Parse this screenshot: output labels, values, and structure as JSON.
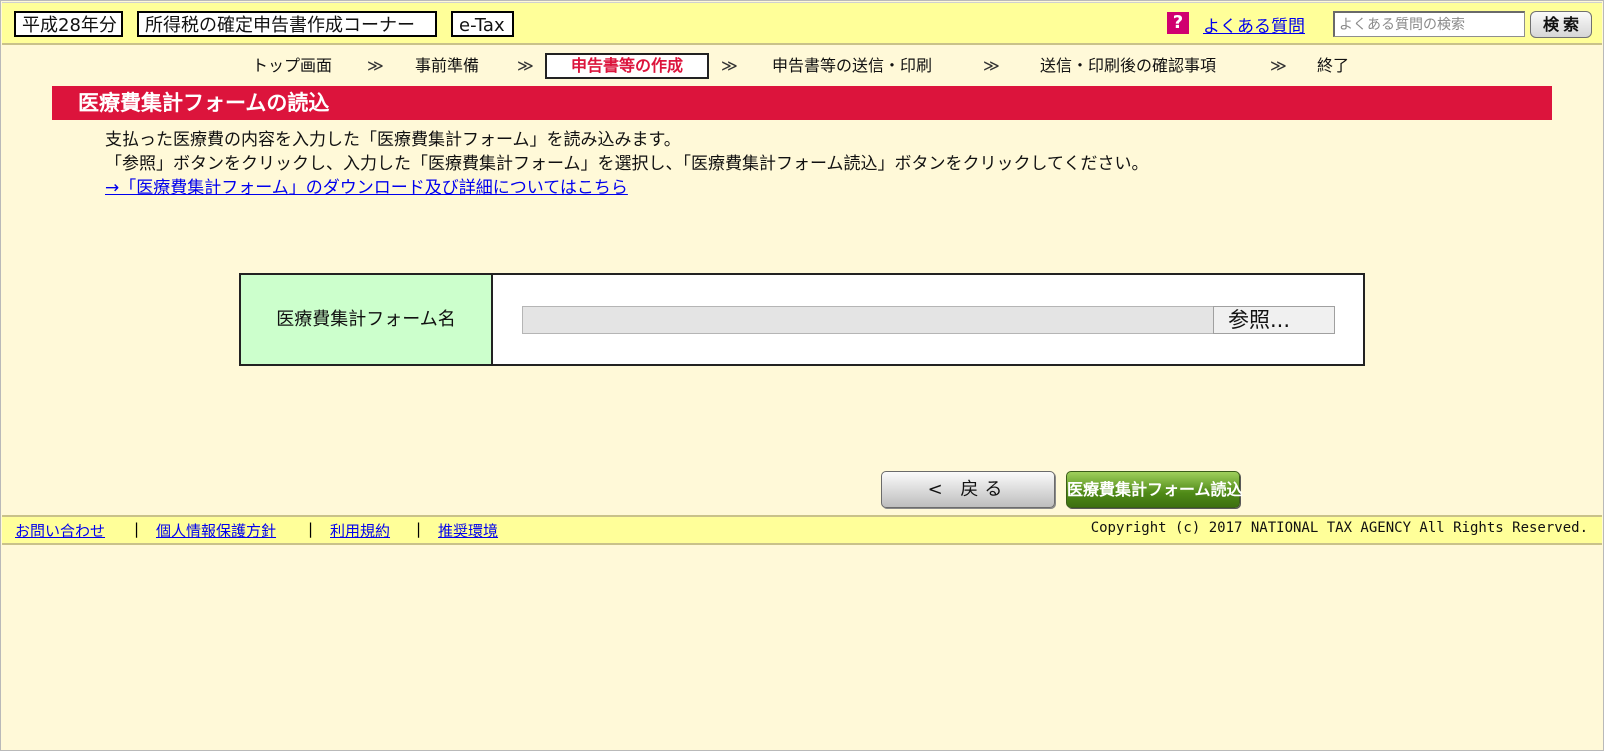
{
  "header": {
    "year_label": "平成28年分",
    "corner_title": "所得税の確定申告書作成コーナー",
    "etax_label": "e-Tax",
    "help_icon": "?",
    "faq_link": "よくある質問",
    "search_placeholder": "よくある質問の検索",
    "search_button": "検索"
  },
  "steps": [
    {
      "label": "トップ画面"
    },
    {
      "label": "事前準備"
    },
    {
      "label": "申告書等の作成",
      "active": true
    },
    {
      "label": "申告書等の送信・印刷"
    },
    {
      "label": "送信・印刷後の確認事項"
    },
    {
      "label": "終了"
    }
  ],
  "step_separator": "≫",
  "section": {
    "title": "医療費集計フォームの読込",
    "desc_line1": "支払った医療費の内容を入力した「医療費集計フォーム」を読み込みます。",
    "desc_line2": "「参照」ボタンをクリックし、入力した「医療費集計フォーム」を選択し、「医療費集計フォーム読込」ボタンをクリックしてください。",
    "desc_link": "→「医療費集計フォーム」のダウンロード及び詳細についてはこちら"
  },
  "form": {
    "label": "医療費集計フォーム名",
    "file_value": "",
    "browse_button": "参照..."
  },
  "buttons": {
    "back": "< 戻る",
    "read": "医療費集計フォーム読込"
  },
  "footer": {
    "links": [
      "お問い合わせ",
      "個人情報保護方針",
      "利用規約",
      "推奨環境"
    ],
    "separator": "|",
    "copyright": "Copyright (c) 2017 NATIONAL TAX AGENCY All Rights Reserved."
  },
  "colors": {
    "header_bg": "#ffff99",
    "page_bg": "#fff9d8",
    "title_bar": "#dc143c",
    "active_step": "#dc143c",
    "form_label_bg": "#ccffcc",
    "read_button": "#4f8a17"
  }
}
